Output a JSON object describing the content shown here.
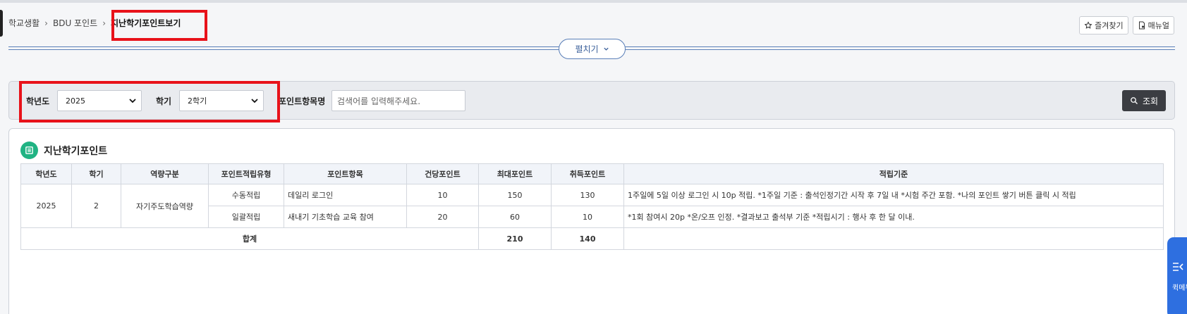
{
  "breadcrumb": {
    "items": [
      "학교생활",
      "BDU 포인트"
    ],
    "current": "지난학기포인트보기"
  },
  "top_buttons": {
    "favorite": "즐겨찾기",
    "manual": "매뉴얼"
  },
  "expand_button": "펼치기",
  "filter": {
    "year_label": "학년도",
    "year_value": "2025",
    "semester_label": "학기",
    "semester_value": "2학기",
    "item_label": "포인트항목명",
    "item_placeholder": "검색어를 입력해주세요.",
    "search_button": "조회"
  },
  "card": {
    "title": "지난학기포인트"
  },
  "table": {
    "columns": [
      "학년도",
      "학기",
      "역량구분",
      "포인트적립유형",
      "포인트항목",
      "건당포인트",
      "최대포인트",
      "취득포인트",
      "적립기준"
    ],
    "group": {
      "year": "2025",
      "semester": "2",
      "competency": "자기주도학습역량"
    },
    "rows": [
      {
        "type": "수동적립",
        "item": "데일리 로그인",
        "per_point": "10",
        "max_point": "150",
        "earned": "130",
        "criteria": "1주일에 5일 이상 로그인 시 10p 적립. *1주일 기준 : 출석인정기간 시작 후 7일 내 *시험 주간 포함. *나의 포인트 쌓기 버튼 클릭 시 적립"
      },
      {
        "type": "일괄적립",
        "item": "새내기 기초학습 교육 참여",
        "per_point": "20",
        "max_point": "60",
        "earned": "10",
        "criteria": "*1회 참여시 20p *온/오프 인정. *결과보고 출석부 기준 *적립시기 : 행사 후 한 달 이내."
      }
    ],
    "total": {
      "label": "합계",
      "max_point": "210",
      "earned": "140"
    }
  },
  "quick_menu": {
    "label": "퀵메뉴"
  },
  "colors": {
    "highlight": "#e8121a",
    "accent_blue": "#5a7fb8",
    "card_icon": "#20b383",
    "search_button": "#3b3d42",
    "quick_menu": "#2e6fe0"
  }
}
